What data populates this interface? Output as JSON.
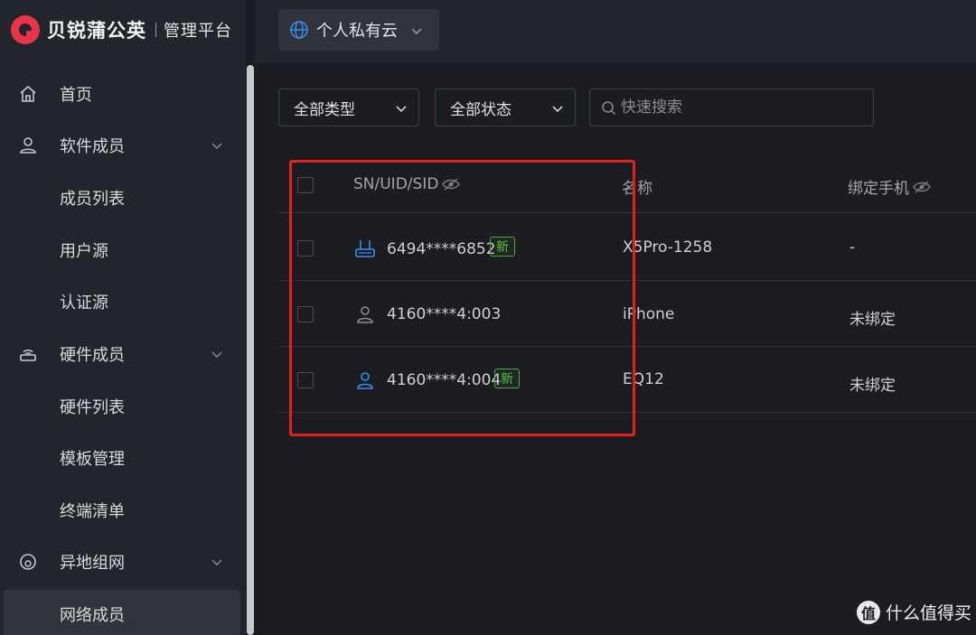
{
  "brand": {
    "name": "贝锐蒲公英",
    "subtitle": "管理平台"
  },
  "sidebar": {
    "items": [
      {
        "label": "首页",
        "icon": "home-icon",
        "expandable": false
      },
      {
        "label": "软件成员",
        "icon": "user-icon",
        "expandable": true
      },
      {
        "label": "成员列表",
        "sub": true
      },
      {
        "label": "用户源",
        "sub": true
      },
      {
        "label": "认证源",
        "sub": true
      },
      {
        "label": "硬件成员",
        "icon": "router-icon",
        "expandable": true
      },
      {
        "label": "硬件列表",
        "sub": true
      },
      {
        "label": "模板管理",
        "sub": true
      },
      {
        "label": "终端清单",
        "sub": true
      },
      {
        "label": "异地组网",
        "icon": "network-icon",
        "expandable": true
      },
      {
        "label": "网络成员",
        "sub": true,
        "active": true
      }
    ]
  },
  "topbar": {
    "cloud_select": "个人私有云"
  },
  "filters": {
    "type": "全部类型",
    "status": "全部状态",
    "search_placeholder": "快速搜索"
  },
  "table": {
    "columns": [
      "SN/UID/SID",
      "名称",
      "绑定手机"
    ],
    "rows": [
      {
        "id": "6494****6852",
        "icon": "router-icon",
        "icon_color": "#3b8cf0",
        "is_new": true,
        "new_label": "新",
        "name": "X5Pro-1258",
        "phone": "-"
      },
      {
        "id": "4160****4:003",
        "icon": "user-icon",
        "icon_color": "#8b8d92",
        "is_new": false,
        "name": "iPhone",
        "phone": "未绑定"
      },
      {
        "id": "4160****4:004",
        "icon": "user-icon",
        "icon_color": "#3b8cf0",
        "is_new": true,
        "new_label": "新",
        "name": "EQ12",
        "phone": "未绑定"
      }
    ]
  },
  "annotation": {
    "color": "#e2231a"
  },
  "watermark": {
    "text": "什么值得买",
    "icon_text": "值"
  },
  "colors": {
    "accent": "#3b8cf0",
    "new_tag": "#5cc246",
    "highlight": "#e2231a"
  }
}
